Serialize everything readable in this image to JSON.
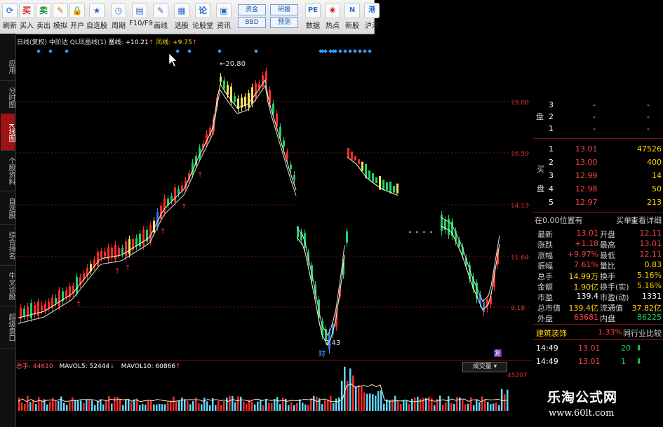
{
  "toolbar": {
    "items": [
      {
        "label": "刷新",
        "icon": "refresh-icon",
        "glyph": "⟳"
      },
      {
        "label": "买入",
        "icon": "buy-icon",
        "glyph": "买"
      },
      {
        "label": "卖出",
        "icon": "sell-icon",
        "glyph": "卖"
      },
      {
        "label": "模拟",
        "icon": "simulate-icon",
        "glyph": "✎"
      },
      {
        "label": "开户",
        "icon": "lock-icon",
        "glyph": "🔒"
      },
      {
        "label": "自选股",
        "icon": "star-icon",
        "glyph": "★"
      },
      {
        "label": "周期",
        "icon": "clock-icon",
        "glyph": "◷"
      },
      {
        "label": "F10/F9",
        "icon": "doc-icon",
        "glyph": "▤"
      },
      {
        "label": "画线",
        "icon": "pen-icon",
        "glyph": "✎"
      },
      {
        "label": "选股",
        "icon": "select-icon",
        "glyph": "▦"
      },
      {
        "label": "论股堂",
        "icon": "speech-icon",
        "glyph": "论"
      },
      {
        "label": "资讯",
        "icon": "news-icon",
        "glyph": "▣"
      }
    ],
    "boxes": [
      {
        "top": "资金",
        "bottom": "BBD"
      },
      {
        "top": "研报",
        "bottom": "预测"
      }
    ],
    "items2": [
      {
        "label": "数据",
        "icon": "pe-icon",
        "glyph": "PE"
      },
      {
        "label": "热点",
        "icon": "fire-icon",
        "glyph": "◉"
      },
      {
        "label": "新股",
        "icon": "new-icon",
        "glyph": "N"
      },
      {
        "label": "沪港",
        "icon": "hk-icon",
        "glyph": "港"
      }
    ]
  },
  "leftnav": [
    {
      "label": "应用",
      "active": false
    },
    {
      "label": "分时图",
      "active": false
    },
    {
      "label": "K线图",
      "active": true
    },
    {
      "label": "个股资料",
      "active": false
    },
    {
      "label": "自选股",
      "active": false
    },
    {
      "label": "综合排名",
      "active": false
    },
    {
      "label": "牛叉诊股",
      "active": false
    },
    {
      "label": "超级盘口",
      "active": false
    }
  ],
  "indicator": {
    "period": "日线(复权)",
    "name": "中阶达",
    "formula": "QL凤凰线(1)",
    "a_label": "凰线:",
    "a_value": "+10.21",
    "b_label": "凤线:",
    "b_value": "+9.75"
  },
  "price_axis": [
    "19.08",
    "16.59",
    "14.13",
    "11.64",
    "9.18"
  ],
  "labels": {
    "high_mark": "←20.80",
    "low_mark": "7.43",
    "cai_tag": "财",
    "fu_tag": "复"
  },
  "volume": {
    "total_label": "总手:",
    "total_value": "44610",
    "ma5_label": "MAVOL5:",
    "ma5_value": "52444",
    "ma10_label": "MAVOL10:",
    "ma10_value": "60866",
    "dropdown_label": "成交量",
    "axis_value": "45207"
  },
  "quote": {
    "sell_levels": [
      {
        "num": "3",
        "price": "-",
        "vol": "-"
      },
      {
        "num": "2",
        "price": "-",
        "vol": "-"
      },
      {
        "num": "1",
        "price": "-",
        "vol": "-"
      }
    ],
    "sell_side_label": "盘",
    "buy_side_label": "买",
    "buy_side_label2": "盘",
    "buy_levels": [
      {
        "num": "1",
        "price": "13.01",
        "vol": "47526"
      },
      {
        "num": "2",
        "price": "13.00",
        "vol": "400"
      },
      {
        "num": "3",
        "price": "12.99",
        "vol": "14"
      },
      {
        "num": "4",
        "price": "12.98",
        "vol": "50"
      },
      {
        "num": "5",
        "price": "12.97",
        "vol": "213"
      }
    ],
    "position_label": "在0.00位置有",
    "buysell_label": "买单↓",
    "detail_label": "查看详细",
    "stats": [
      {
        "l1": "最新",
        "v1": "13.01",
        "c1": "red",
        "l2": "开盘",
        "v2": "12.11",
        "c2": "red"
      },
      {
        "l1": "涨跌",
        "v1": "+1.18",
        "c1": "red",
        "l2": "最高",
        "v2": "13.01",
        "c2": "red"
      },
      {
        "l1": "涨幅",
        "v1": "+9.97%",
        "c1": "red",
        "l2": "最低",
        "v2": "12.11",
        "c2": "red"
      },
      {
        "l1": "振幅",
        "v1": "7.61%",
        "c1": "red",
        "l2": "量比",
        "v2": "0.83",
        "c2": "yel"
      },
      {
        "l1": "总手",
        "v1": "14.99万",
        "c1": "yel",
        "l2": "换手",
        "v2": "5.16%",
        "c2": "yel"
      },
      {
        "l1": "金额",
        "v1": "1.90亿",
        "c1": "yel",
        "l2": "换手(实)",
        "v2": "5.16%",
        "c2": "yel"
      },
      {
        "l1": "市盈",
        "v1": "139.4",
        "c1": "wh",
        "l2": "市盈(动)",
        "v2": "1331",
        "c2": "wh"
      },
      {
        "l1": "总市值",
        "v1": "139.4亿",
        "c1": "yel",
        "l2": "流通值",
        "v2": "37.82亿",
        "c2": "yel"
      },
      {
        "l1": "外盘",
        "v1": "63681",
        "c1": "red",
        "l2": "内盘",
        "v2": "86225",
        "c2": "grn"
      }
    ],
    "industry": "建筑装饰",
    "industry_pct": "1.33%",
    "industry_rank": "同行业比较",
    "ticks": [
      {
        "time": "14:49",
        "price": "13.01",
        "vol": "20",
        "dir": "down"
      },
      {
        "time": "14:49",
        "price": "13.01",
        "vol": "1",
        "dir": "down"
      }
    ]
  },
  "watermark": {
    "cn": "乐淘公式网",
    "url": "www.60lt.com"
  },
  "colors": {
    "up": "#ff2a2a",
    "down": "#19d36a",
    "yellow": "#f5e35a",
    "blue": "#2f73ff",
    "ma": "#f3efc0",
    "grid_red": "#7a1111",
    "volume_bar": "#5fd6ff"
  }
}
